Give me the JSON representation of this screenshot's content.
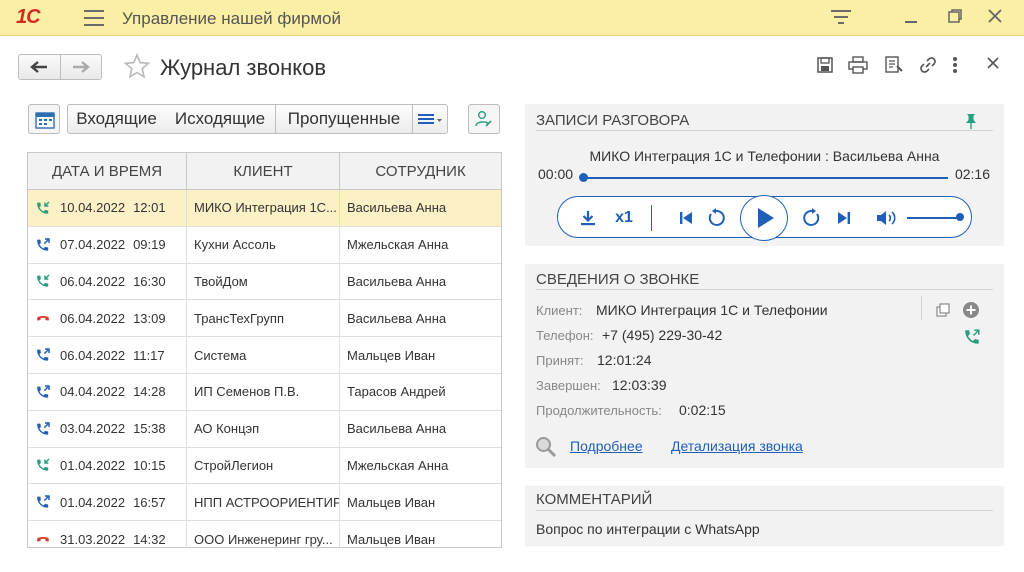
{
  "app": {
    "logo": "1С",
    "title": "Управление нашей фирмой",
    "icons": [
      "hamburger-icon",
      "filter-icon",
      "minimize-icon",
      "restore-icon",
      "close-icon"
    ]
  },
  "window": {
    "title": "Журнал звонков",
    "header_icons": [
      "save-icon",
      "print-icon",
      "report-icon",
      "link-icon",
      "more-icon",
      "close-icon"
    ]
  },
  "filters": {
    "buttons": [
      "Входящие",
      "Исходящие",
      "Пропущенные"
    ],
    "selected": "Входящие"
  },
  "table": {
    "columns": [
      "ДАТА И ВРЕМЯ",
      "КЛИЕНТ",
      "СОТРУДНИК"
    ],
    "rows": [
      {
        "type": "incoming",
        "date": "10.04.2022",
        "time": "12:01",
        "client": "МИКО Интеграция 1С...",
        "employee": "Васильева Анна"
      },
      {
        "type": "outgoing",
        "date": "07.04.2022",
        "time": "09:19",
        "client": "Кухни Ассоль",
        "employee": "Мжельская Анна"
      },
      {
        "type": "incoming",
        "date": "06.04.2022",
        "time": "16:30",
        "client": "ТвойДом",
        "employee": "Васильева Анна"
      },
      {
        "type": "missed",
        "date": "06.04.2022",
        "time": "13:09",
        "client": "ТрансТехГрупп",
        "employee": "Васильева Анна"
      },
      {
        "type": "outgoing",
        "date": "06.04.2022",
        "time": "11:17",
        "client": "Система",
        "employee": "Мальцев Иван"
      },
      {
        "type": "outgoing",
        "date": "04.04.2022",
        "time": "14:28",
        "client": "ИП Семенов П.В.",
        "employee": "Тарасов Андрей"
      },
      {
        "type": "outgoing",
        "date": "03.04.2022",
        "time": "15:38",
        "client": "АО Концэп",
        "employee": "Васильева Анна"
      },
      {
        "type": "incoming",
        "date": "01.04.2022",
        "time": "10:15",
        "client": "СтройЛегион",
        "employee": "Мжельская Анна"
      },
      {
        "type": "outgoing",
        "date": "01.04.2022",
        "time": "16:57",
        "client": "НПП АСТРООРИЕНТИР",
        "employee": "Мальцев Иван"
      },
      {
        "type": "missed",
        "date": "31.03.2022",
        "time": "14:32",
        "client": "ООО Инженеринг гру...",
        "employee": "Мальцев Иван"
      }
    ]
  },
  "recordings": {
    "title": "ЗАПИСИ РАЗГОВОРА",
    "name": "МИКО Интеграция 1С и Телефонии : Васильева Анна",
    "time_start": "00:00",
    "time_end": "02:16",
    "speed": "x1",
    "progress": 0.0
  },
  "call_info": {
    "title": "СВЕДЕНИЯ О ЗВОНКЕ",
    "client_label": "Клиент:",
    "client": "МИКО Интеграция 1С и Телефонии",
    "phone_label": "Телефон:",
    "phone": "+7 (495) 229-30-42",
    "accepted_label": "Принят:",
    "accepted": "12:01:24",
    "finished_label": "Завершен:",
    "finished": "12:03:39",
    "duration_label": "Продолжительность:",
    "duration": "0:02:15",
    "link_more": "Подробнее",
    "link_detail": "Детализация звонка"
  },
  "comment": {
    "title": "КОММЕНТАРИЙ",
    "text": "Вопрос по интеграции с WhatsApp"
  },
  "colors": {
    "title_bar": "#fbeea5",
    "accent_blue": "#1f5fb8",
    "incoming_green": "#2a9d7f",
    "missed_red": "#d83a2e",
    "selected_row": "#fbf0c6"
  }
}
